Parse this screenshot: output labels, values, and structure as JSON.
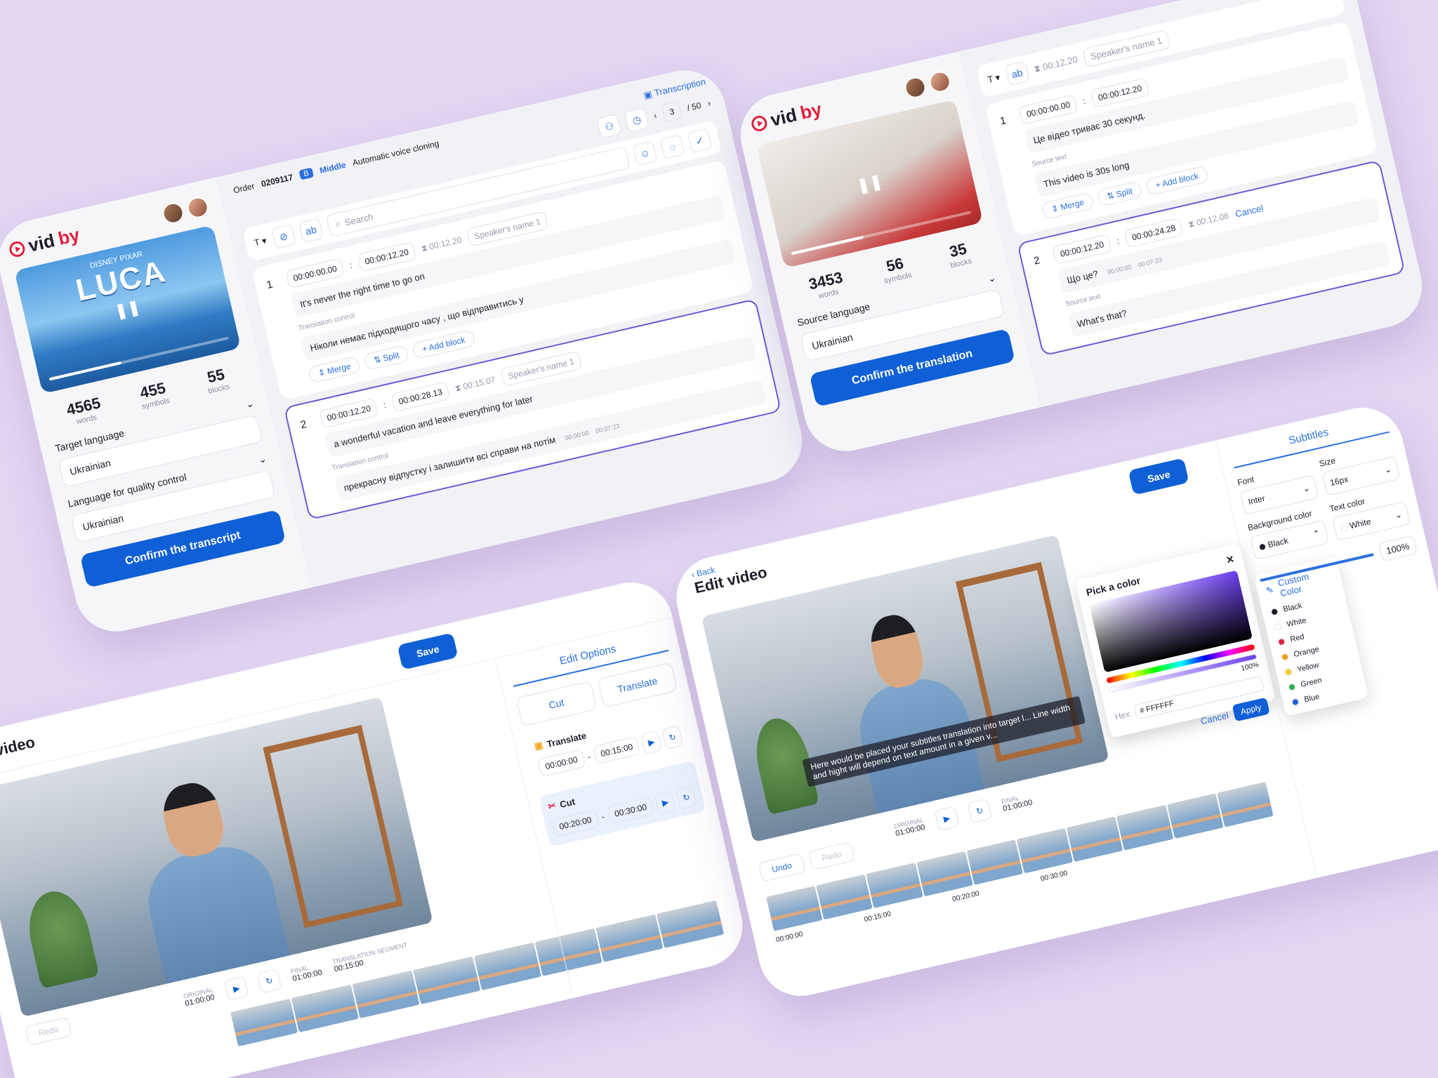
{
  "card1": {
    "logo_vid": "vid",
    "logo_by": "by",
    "video_title": "LUCA",
    "video_sub": "DISNEY PIXAR",
    "stats": [
      {
        "value": "4565",
        "label": "words"
      },
      {
        "value": "455",
        "label": "symbols"
      },
      {
        "value": "55",
        "label": "blocks"
      }
    ],
    "target_language_label": "Target language",
    "target_language_value": "Ukrainian",
    "qc_language_label": "Language for quality control",
    "qc_language_value": "Ukrainian",
    "confirm_btn": "Confirm the transcript",
    "transcription_link": "Transcription",
    "order_label": "Order",
    "order_number": "0209117",
    "badge": "B",
    "tier": "Middle",
    "voice": "Automatic voice cloning",
    "page_current": "3",
    "page_total": "/ 50",
    "search_placeholder": "Search",
    "toolbar_t": "T",
    "blocks": [
      {
        "num": "1",
        "start": "00:00:00.00",
        "end": "00:00:12.20",
        "dur": "00:12.20",
        "speaker": "Speaker's name 1",
        "text": "It's never the right time to go on",
        "control_label": "Translation control",
        "translation": "Ніколи немає підходящого часу , що відправитись у"
      },
      {
        "num": "2",
        "start": "00:00:12.20",
        "end": "00:00:28.13",
        "dur": "00:15.07",
        "speaker": "Speaker's name 1",
        "text": "a wonderful vacation and leave everything for later",
        "control_label": "Translation control",
        "translation": "прекрасну відпустку і залишити всі справи на потім",
        "mini_start": "00:00:00",
        "mini_end": "00:07:23"
      }
    ],
    "merge": "Merge",
    "split": "Split",
    "add_block": "Add block"
  },
  "card2": {
    "logo_vid": "vid",
    "logo_by": "by",
    "stats": [
      {
        "value": "3453",
        "label": "words"
      },
      {
        "value": "56",
        "label": "symbols"
      },
      {
        "value": "35",
        "label": "blocks"
      }
    ],
    "source_language_label": "Source language",
    "source_language_value": "Ukrainian",
    "confirm_btn": "Confirm the translation",
    "dur_top": "00:12.20",
    "speaker": "Speaker's name 1",
    "blocks": [
      {
        "num": "1",
        "start": "00:00:00.00",
        "end": "00:00:12.20",
        "text": "Це відео триває 30 секунд.",
        "source_label": "Source text",
        "source": "This video is 30s long"
      },
      {
        "num": "2",
        "start": "00:00:12.20",
        "end": "00:00:24.28",
        "dur": "00:12.08",
        "text": "Що це?",
        "mini_start": "00:00:00",
        "mini_end": "00:07:23",
        "source_label": "Source text",
        "source": "What's that?",
        "cancel": "Cancel"
      }
    ],
    "merge": "Merge",
    "split": "Split",
    "add_block": "Add block"
  },
  "card3": {
    "title": "Edit video",
    "save": "Save",
    "panel_title": "Edit Options",
    "cut_btn": "Cut",
    "translate_btn": "Translate",
    "segments": [
      {
        "icon": "translate-icon",
        "label": "Translate",
        "start": "00:00:00",
        "end": "00:15:00"
      },
      {
        "icon": "scissors-icon",
        "label": "Cut",
        "start": "00:20:00",
        "end": "00:30:00"
      }
    ],
    "original_label": "ORIGINAL",
    "original_value": "01:00:00",
    "final_label": "FINAL",
    "final_value": "01:00:00",
    "segment_label": "TRANSLATION SEGMENT",
    "segment_value": "00:15:00",
    "redo": "Redo"
  },
  "card4": {
    "back": "Back",
    "title": "Edit video",
    "save": "Save",
    "panel_title": "Subtitles",
    "font_label": "Font",
    "font_value": "Inter",
    "size_label": "Size",
    "size_value": "16px",
    "bg_label": "Background color",
    "bg_value": "Black",
    "text_color_label": "Text color",
    "text_color_value": "White",
    "opacity": "100%",
    "subtitle_text": "Here would be placed your subtitles translation into target l... Line width and hight will depend on text amount in a given v...",
    "picker_title": "Pick a color",
    "hex_label": "Hex",
    "hex_value": "# FFFFFF",
    "alpha_value": "100%",
    "cancel": "Cancel",
    "apply": "Apply",
    "custom_color": "Custom Color",
    "colors": [
      {
        "name": "Black",
        "hex": "#1d1d2b"
      },
      {
        "name": "White",
        "hex": "#ffffff"
      },
      {
        "name": "Red",
        "hex": "#e0213b"
      },
      {
        "name": "Orange",
        "hex": "#f59a1b"
      },
      {
        "name": "Yellow",
        "hex": "#f5d21b"
      },
      {
        "name": "Green",
        "hex": "#2bb24c"
      },
      {
        "name": "Blue",
        "hex": "#1b5fd6"
      }
    ],
    "original_label": "ORIGINAL",
    "original_value": "01:00:00",
    "final_label": "FINAL",
    "final_value": "01:00:00",
    "undo": "Undo",
    "redo": "Redo",
    "tl_marks": [
      "00:00:00",
      "00:15:00",
      "00:20:00",
      "00:30:00"
    ]
  }
}
